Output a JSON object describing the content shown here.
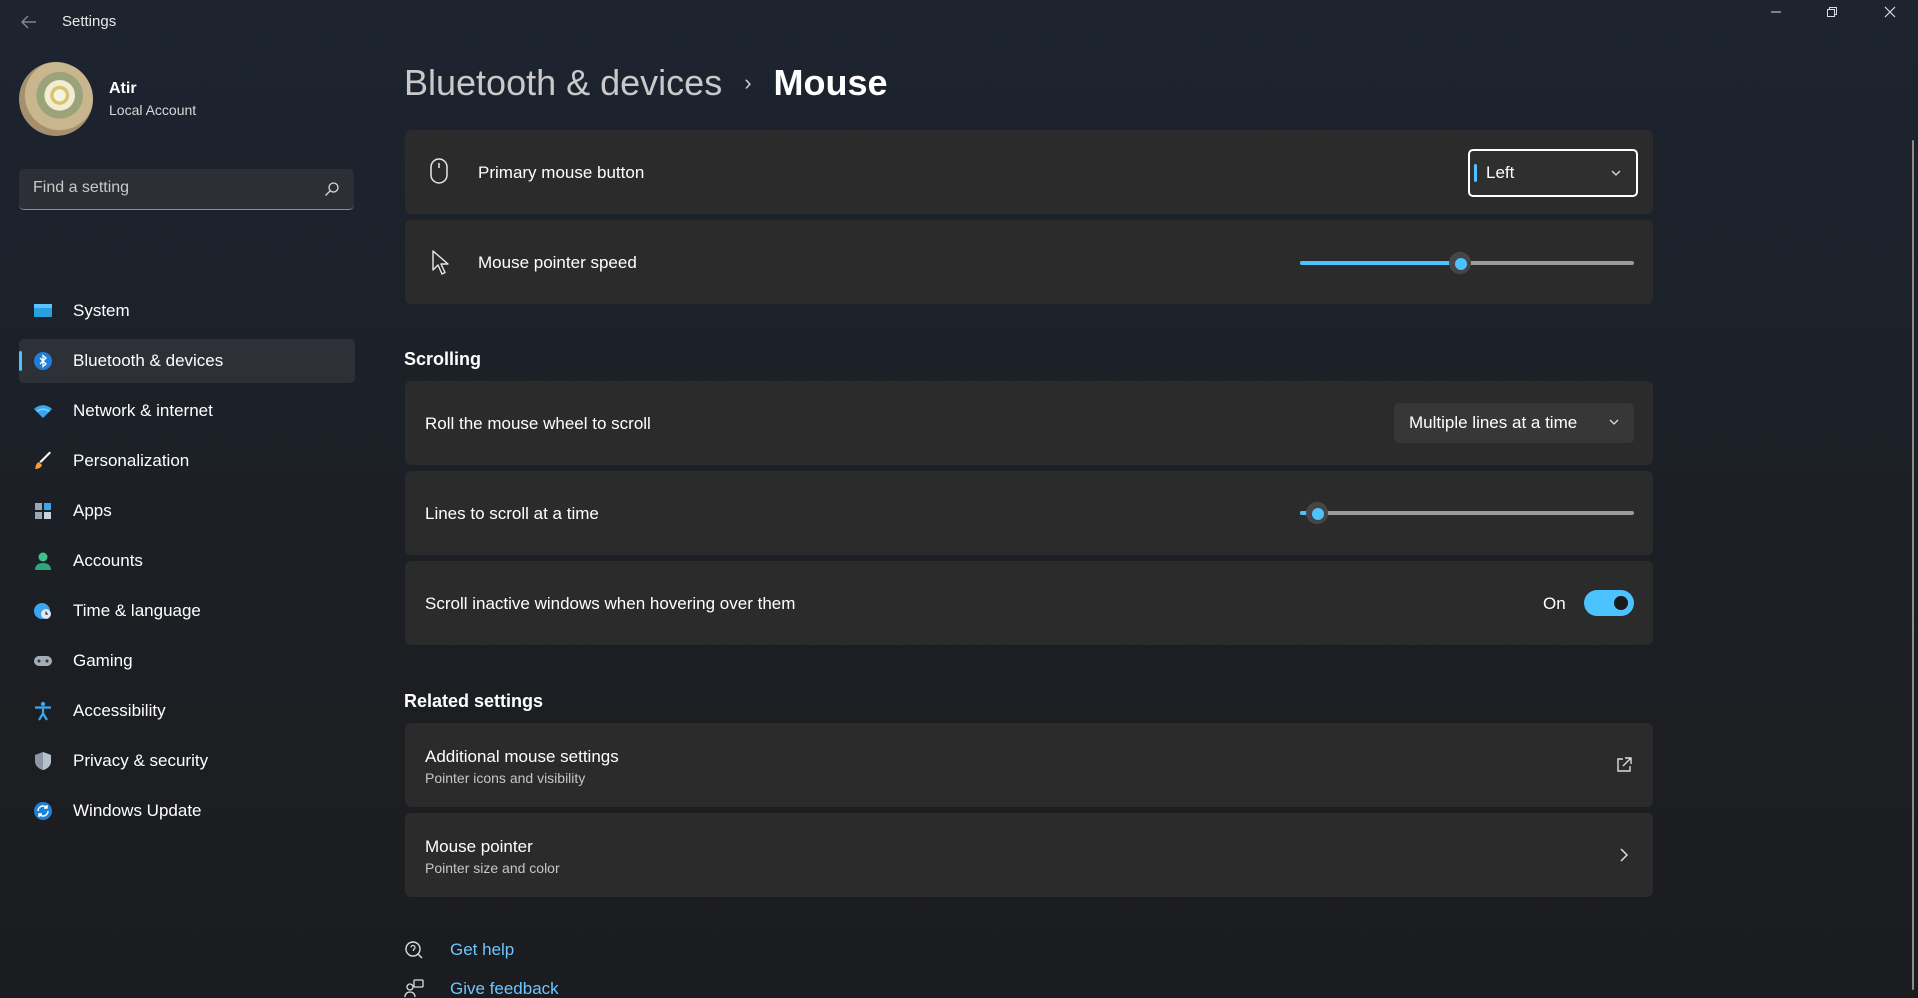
{
  "window": {
    "title": "Settings",
    "controls": [
      "minimize",
      "restore",
      "close"
    ]
  },
  "profile": {
    "name": "Atir",
    "account_type": "Local Account"
  },
  "search": {
    "placeholder": "Find a setting"
  },
  "sidebar": {
    "items": [
      {
        "label": "System",
        "icon": "system-icon"
      },
      {
        "label": "Bluetooth & devices",
        "icon": "bluetooth-icon",
        "active": true
      },
      {
        "label": "Network & internet",
        "icon": "wifi-icon"
      },
      {
        "label": "Personalization",
        "icon": "brush-icon"
      },
      {
        "label": "Apps",
        "icon": "apps-icon"
      },
      {
        "label": "Accounts",
        "icon": "person-icon"
      },
      {
        "label": "Time & language",
        "icon": "globe-clock-icon"
      },
      {
        "label": "Gaming",
        "icon": "gamepad-icon"
      },
      {
        "label": "Accessibility",
        "icon": "accessibility-icon"
      },
      {
        "label": "Privacy & security",
        "icon": "shield-icon"
      },
      {
        "label": "Windows Update",
        "icon": "update-icon"
      }
    ]
  },
  "breadcrumb": {
    "parent": "Bluetooth & devices",
    "separator": "›",
    "current": "Mouse"
  },
  "settings": {
    "primary_button": {
      "label": "Primary mouse button",
      "value": "Left"
    },
    "pointer_speed": {
      "label": "Mouse pointer speed",
      "level": 0.48
    }
  },
  "scrolling": {
    "title": "Scrolling",
    "roll_wheel": {
      "label": "Roll the mouse wheel to scroll",
      "value": "Multiple lines at a time"
    },
    "lines": {
      "label": "Lines to scroll at a time",
      "level": 0.05
    },
    "inactive": {
      "label": "Scroll inactive windows when hovering over them",
      "state": "On"
    }
  },
  "related": {
    "title": "Related settings",
    "additional": {
      "label": "Additional mouse settings",
      "sub": "Pointer icons and visibility"
    },
    "pointer": {
      "label": "Mouse pointer",
      "sub": "Pointer size and color"
    }
  },
  "help": {
    "get_help": "Get help",
    "feedback": "Give feedback"
  },
  "colors": {
    "accent": "#4cc2ff",
    "card": "#2b2b2b",
    "link": "#6cc6ff"
  }
}
